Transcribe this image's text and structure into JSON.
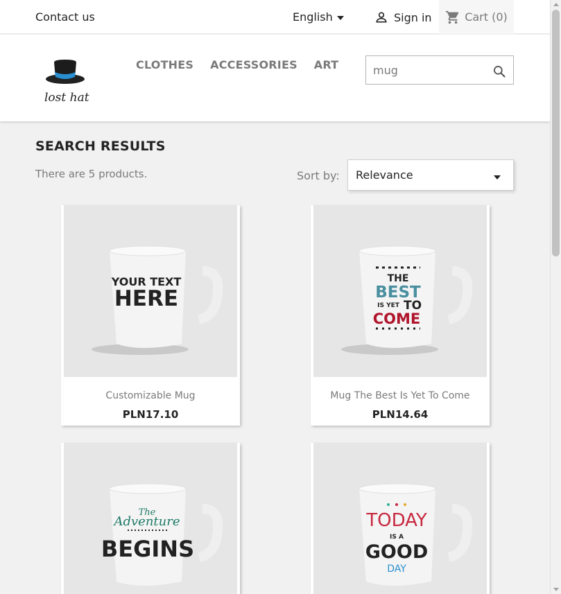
{
  "topbar": {
    "contact": "Contact us",
    "language": "English",
    "signin": "Sign in",
    "cart": "Cart (0)"
  },
  "header": {
    "logo_text": "lost hat",
    "menu": [
      "CLOTHES",
      "ACCESSORIES",
      "ART"
    ],
    "search_value": "mug"
  },
  "results": {
    "title": "SEARCH RESULTS",
    "count": "There are 5 products.",
    "sort_label": "Sort by:",
    "sort_value": "Relevance"
  },
  "products": [
    {
      "name": "Customizable Mug",
      "price": "PLN17.10",
      "print": [
        "YOUR TEXT",
        "HERE"
      ]
    },
    {
      "name": "Mug The Best Is Yet To Come",
      "price": "PLN14.64",
      "print": [
        "THE",
        "BEST",
        "IS YET",
        "TO",
        "COME"
      ]
    },
    {
      "name": "",
      "price": "",
      "print": [
        "The",
        "Adventure",
        "BEGINS"
      ]
    },
    {
      "name": "",
      "price": "",
      "print": [
        "TODAY",
        "IS A",
        "GOOD",
        "DAY"
      ]
    }
  ],
  "colors": {
    "accent_teal": "#4a8fa0",
    "accent_red": "#b0142b",
    "text_dark": "#232323",
    "text_grey": "#7a7a7a"
  }
}
